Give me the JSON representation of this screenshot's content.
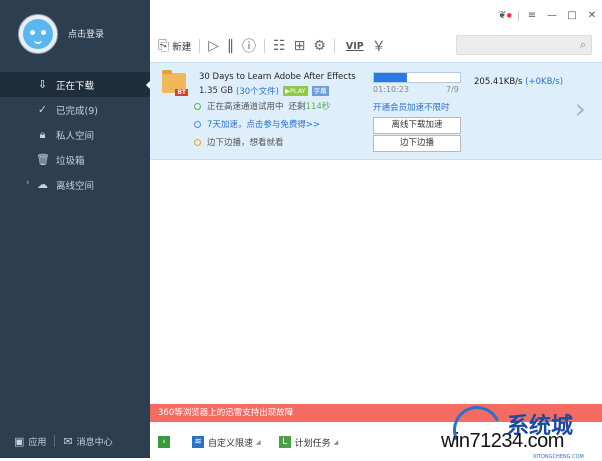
{
  "sidebar": {
    "login_text": "点击登录",
    "items": [
      {
        "label": "正在下载",
        "icon": "download-arrow-icon"
      },
      {
        "label": "已完成(9)",
        "icon": "check-circle-icon"
      },
      {
        "label": "私人空间",
        "icon": "lock-icon"
      },
      {
        "label": "垃圾箱",
        "icon": "trash-icon"
      },
      {
        "label": "离线空间",
        "icon": "offline-space-icon"
      }
    ],
    "bottom": {
      "apps_label": "应用",
      "messages_label": "消息中心"
    }
  },
  "toolbar": {
    "new_label": "新建",
    "vip_label": "VIP"
  },
  "task": {
    "title": "30 Days to Learn Adobe After Effects",
    "size": "1.35 GB",
    "files": "(30个文件)",
    "play_badge": "▶PLAY",
    "subtitle_badge": "字幕",
    "progress_text": "38.8%",
    "progress_value": 38.8,
    "elapsed": "01:10:23",
    "count": "7/9",
    "speed": "205.41KB/s",
    "speed_extra": "(+0KB/s)",
    "line1_prefix": "正在高速通道试用中",
    "line1_suffix": "还剩",
    "line1_highlight": "114秒",
    "line2": "7天加速，点击参与免费得>>",
    "line3": "边下边播，想看就看",
    "vip_text": "开通会员加速不限时",
    "btn_offline": "离线下载加速",
    "btn_play": "边下边播",
    "file_badge": "BT"
  },
  "notice": "360等浏览器上的迅雷支持出现故障",
  "bottombar": {
    "custom_speed": "自定义限速",
    "schedule": "计划任务"
  },
  "watermark": {
    "domain": "win71234.com",
    "cn": "系统城",
    "small": "XITONGCHENG.COM"
  },
  "colors": {
    "sidebar_bg": "#2c3e50",
    "task_bg": "#dfeefb",
    "accent_blue": "#2a72c9",
    "notice_bg": "#f36b62"
  }
}
